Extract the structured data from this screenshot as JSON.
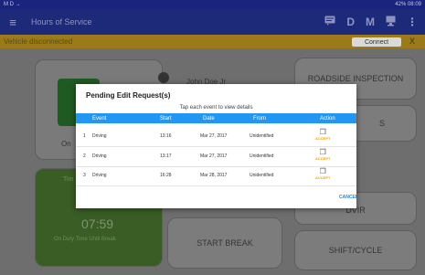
{
  "statusbar": {
    "left_icons": "M D →",
    "right_text": "42% 08:09"
  },
  "appbar": {
    "menu_icon": "≡",
    "title": "Hours of Service",
    "icons": [
      "message-icon",
      "D",
      "M",
      "device-icon",
      "⋮"
    ]
  },
  "banner": {
    "text": "Vehicle disconnected",
    "connect_label": "Connect",
    "close_label": "X"
  },
  "background": {
    "driver_name": "John Doe Jr",
    "status_label": "On",
    "timer_small": "Tim",
    "timer_value": "07:59",
    "timer_caption": "On Duty Time Until Break",
    "tiles": {
      "roadside": "ROADSIDE INSPECTION",
      "logs": "S",
      "dvir": "DVIR",
      "start_break": "START BREAK",
      "shift_cycle": "SHIFT/CYCLE"
    }
  },
  "dialog": {
    "title": "Pending Edit Request(s)",
    "hint": "Tap each event to view details",
    "columns": [
      "Event",
      "Start",
      "Date",
      "From",
      "Action"
    ],
    "rows": [
      {
        "num": "1",
        "event": "Driving",
        "start": "13:16",
        "date": "Mar 27, 2017",
        "from": "Unidentified",
        "action": "ACCEPT"
      },
      {
        "num": "2",
        "event": "Driving",
        "start": "13:17",
        "date": "Mar 27, 2017",
        "from": "Unidentified",
        "action": "ACCEPT"
      },
      {
        "num": "3",
        "event": "Driving",
        "start": "16:28",
        "date": "Mar 28, 2017",
        "from": "Unidentified",
        "action": "ACCEPT"
      }
    ],
    "cancel_label": "CANCEL"
  }
}
